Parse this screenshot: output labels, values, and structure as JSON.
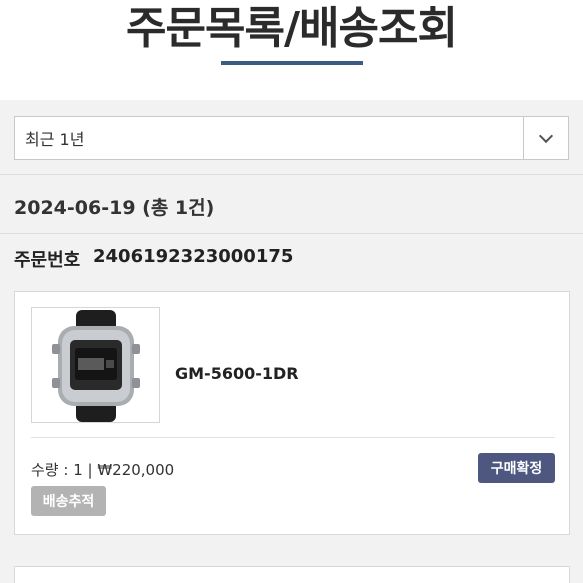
{
  "header": {
    "title": "주문목록/배송조회"
  },
  "filter": {
    "period_value": "최근 1년"
  },
  "date_group": {
    "label": "2024-06-19 (총 1건)"
  },
  "order": {
    "number_label": "주문번호",
    "number": "2406192323000175",
    "item": {
      "image_icon": "watch-product-image",
      "name": "GM-5600-1DR",
      "qty_line": "수량 : 1 | ₩220,000",
      "confirm_label": "구매확정",
      "track_label": "배송추적"
    }
  },
  "colors": {
    "accent_underline": "#3d5a80",
    "confirm_button": "#4d5780",
    "track_button": "#b3b3b3"
  }
}
